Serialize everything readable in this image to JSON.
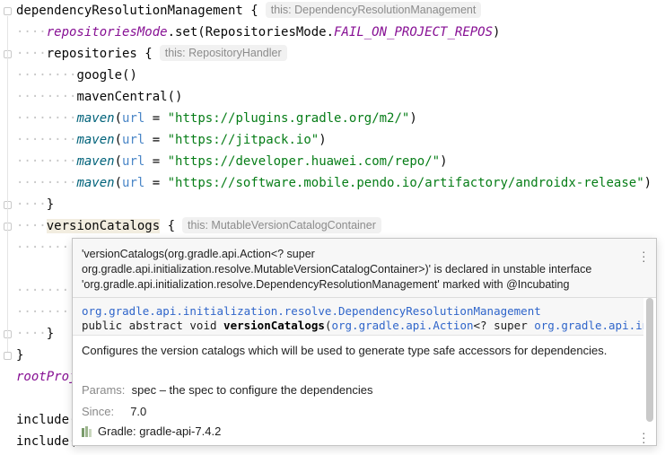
{
  "editor": {
    "lines": [
      {
        "a": "dependencyResolutionManagement",
        "b": " {",
        "hint": "this: DependencyResolutionManagement"
      },
      {
        "field": "repositoriesMode",
        "dot": ".set(",
        "cls": "RepositoriesMode",
        "dot2": ".",
        "const": "FAIL_ON_PROJECT_REPOS",
        "end": ")"
      },
      {
        "a": "repositories",
        "b": " {",
        "hint": "this: RepositoryHandler"
      },
      {
        "a": "google()"
      },
      {
        "a": "mavenCentral()"
      },
      {
        "m": "maven",
        "p": "(",
        "param": "url",
        "eq": " = ",
        "s": "\"https://plugins.gradle.org/m2/\"",
        "e": ")"
      },
      {
        "m": "maven",
        "p": "(",
        "param": "url",
        "eq": " = ",
        "s": "\"https://jitpack.io\"",
        "e": ")"
      },
      {
        "m": "maven",
        "p": "(",
        "param": "url",
        "eq": " = ",
        "s": "\"https://developer.huawei.com/repo/\"",
        "e": ")"
      },
      {
        "m": "maven",
        "p": "(",
        "param": "url",
        "eq": " = ",
        "s": "\"https://software.mobile.pendo.io/artifactory/androidx-release\"",
        "e": ")"
      },
      {
        "a": "}"
      },
      {
        "pre": "vers",
        "hl": "ionCatalogs",
        "b": " {",
        "hint": "this: MutableVersionCatalogContainer"
      },
      {
        "a": "}"
      },
      {
        "a": "}"
      },
      {
        "field": "rootProj"
      },
      {
        "a": "include("
      },
      {
        "a": "include("
      }
    ]
  },
  "popup": {
    "warning": "'versionCatalogs(org.gradle.api.Action<? super org.gradle.api.initialization.resolve.MutableVersionCatalogContainer>)' is declared in unstable interface 'org.gradle.api.initialization.resolve.DependencyResolutionManagement' marked with @Incubating",
    "sig_class": "org.gradle.api.initialization.resolve.DependencyResolutionManagement",
    "sig_prefix": "public abstract void ",
    "sig_method": "versionCatalogs",
    "sig_paren": "(",
    "sig_type": "org.gradle.api.Action",
    "sig_mid": "<? super ",
    "sig_tail": "org.gradle.api.initializ",
    "description": "Configures the version catalogs which will be used to generate type safe accessors for dependencies.",
    "params_label": "Params:",
    "params_value": "spec – the spec to configure the dependencies",
    "since_label": "Since:",
    "since_value": "7.0",
    "library": "Gradle: gradle-api-7.4.2"
  },
  "icons": [
    "fold-icon",
    "more-actions-icon",
    "library-icon"
  ]
}
